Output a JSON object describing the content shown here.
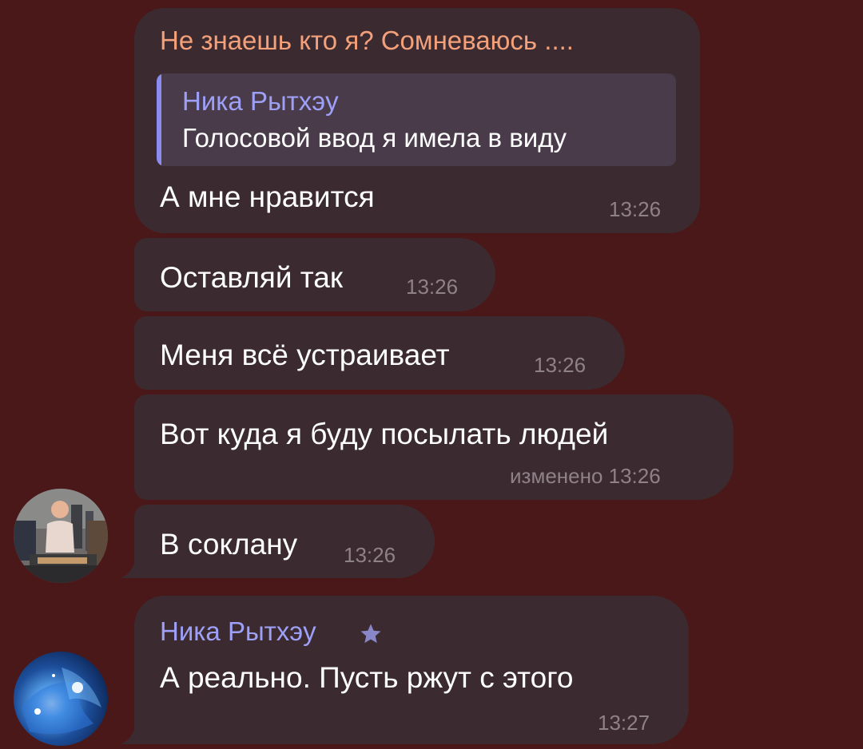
{
  "colors": {
    "background": "#4a1818",
    "bubble": "#3b2b30",
    "sender_orange": "#f4a07a",
    "sender_purple": "#9ea0f7",
    "time": "#8f8188",
    "reply_background": "#4a3b4a",
    "reply_bar": "#8b8cf2"
  },
  "messages": [
    {
      "sender": "Не знаешь кто я? Сомневаюсь ....",
      "reply": {
        "name": "Ника Рытхэу",
        "text": "Голосовой ввод я имела в виду"
      },
      "text": "А мне нравится",
      "time": "13:26"
    },
    {
      "text": "Оставляй так",
      "time": "13:26"
    },
    {
      "text": "Меня всё устраивает",
      "time": "13:26"
    },
    {
      "text": "Вот куда я буду посылать людей",
      "time": "изменено 13:26"
    },
    {
      "text": "В соклану",
      "time": "13:26",
      "avatar": "user-avatar-photo"
    },
    {
      "sender": "Ника Рытхэу",
      "sender_badge": "star-icon",
      "text": "А реально. Пусть ржут с этого",
      "time": "13:27",
      "avatar": "user-avatar-space"
    }
  ]
}
